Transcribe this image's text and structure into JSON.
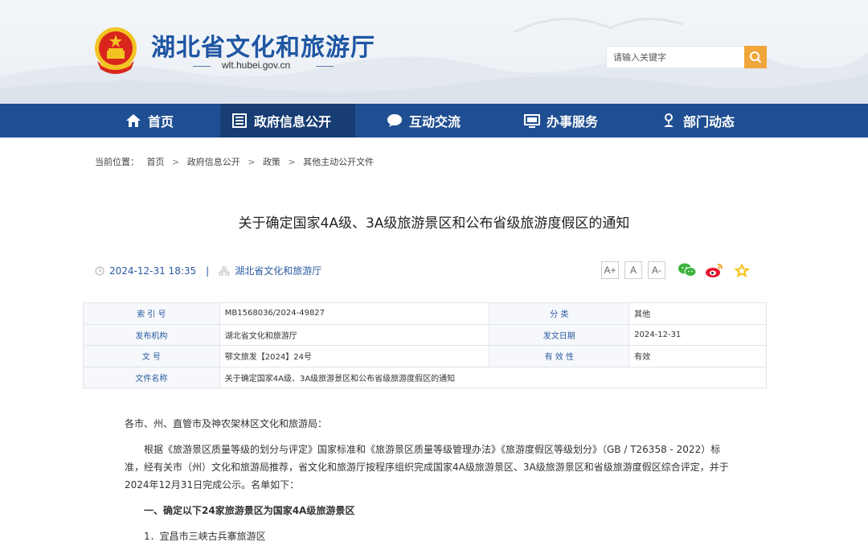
{
  "header": {
    "site_title": "湖北省文化和旅游厅",
    "site_url": "wlt.hubei.gov.cn",
    "search_placeholder": "请输入关键字"
  },
  "nav": [
    {
      "label": "首页",
      "icon": "home-icon"
    },
    {
      "label": "政府信息公开",
      "icon": "document-list-icon",
      "active": true
    },
    {
      "label": "互动交流",
      "icon": "chat-bubble-icon"
    },
    {
      "label": "办事服务",
      "icon": "monitor-icon"
    },
    {
      "label": "部门动态",
      "icon": "pin-person-icon"
    }
  ],
  "breadcrumb": {
    "prefix": "当前位置：",
    "items": [
      "首页",
      "政府信息公开",
      "政策",
      "其他主动公开文件"
    ],
    "separator": ">"
  },
  "article": {
    "title": "关于确定国家4A级、3A级旅游景区和公布省级旅游度假区的通知",
    "datetime": "2024-12-31 18:35",
    "meta_separator": "|",
    "publisher": "湖北省文化和旅游厅",
    "font_buttons": [
      "A+",
      "A",
      "A-"
    ]
  },
  "info_table": {
    "index_label": "索 引 号",
    "index_value": "MB1568036/2024-49827",
    "category_label": "分 类",
    "category_value": "其他",
    "issuer_label": "发布机构",
    "issuer_value": "湖北省文化和旅游厅",
    "date_label": "发文日期",
    "date_value": "2024-12-31",
    "docno_label": "文 号",
    "docno_value": "鄂文旅发【2024】24号",
    "validity_label": "有 效 性",
    "validity_value": "有效",
    "filename_label": "文件名称",
    "filename_value": "关于确定国家4A级、3A级旅游景区和公布省级旅游度假区的通知"
  },
  "body": {
    "greeting": "各市、州、直管市及神农架林区文化和旅游局：",
    "paragraph1": "根据《旅游景区质量等级的划分与评定》国家标准和《旅游景区质量等级管理办法》《旅游度假区等级划分》（GB / T26358 - 2022）标准，经有关市（州）文化和旅游局推荐，省文化和旅游厅按程序组织完成国家4A级旅游景区、3A级旅游景区和省级旅游度假区综合评定，并于2024年12月31日完成公示。名单如下：",
    "heading1": "一、确定以下24家旅游景区为国家4A级旅游景区",
    "item1": "1．宜昌市三峡古兵寨旅游区"
  },
  "colors": {
    "nav_bg": "#1f4f92",
    "nav_active": "#173d74",
    "title_blue": "#1f56a3",
    "search_button": "#f0a63a"
  }
}
